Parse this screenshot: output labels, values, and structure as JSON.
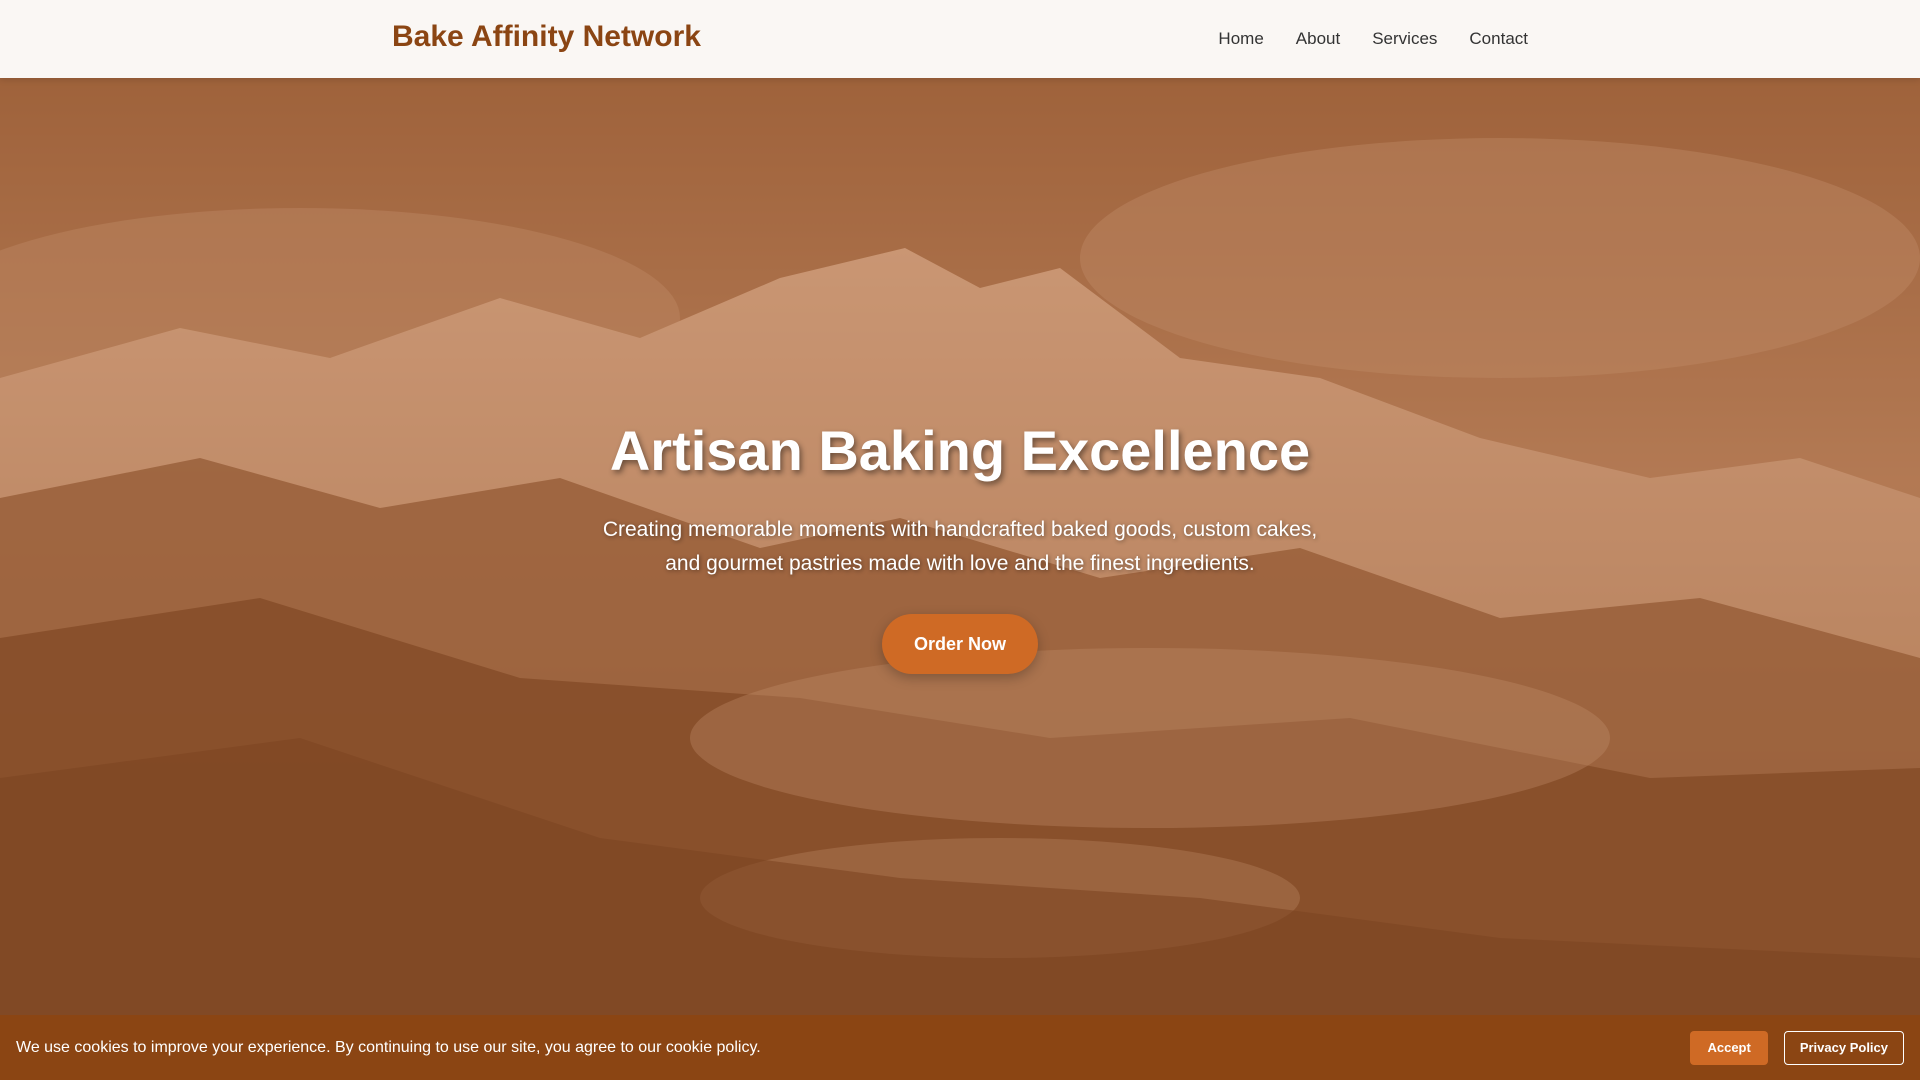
{
  "header": {
    "logo": "Bake Affinity Network",
    "nav": [
      "Home",
      "About",
      "Services",
      "Contact"
    ]
  },
  "hero": {
    "title": "Artisan Baking Excellence",
    "subtitle": "Creating memorable moments with handcrafted baked goods, custom cakes, and gourmet pastries made with love and the finest ingredients.",
    "cta_label": "Order Now",
    "background": "snowy-mountain-photo"
  },
  "cookie_banner": {
    "text": "We use cookies to improve your experience. By continuing to use our site, you agree to our cookie policy.",
    "accept_label": "Accept",
    "privacy_label": "Privacy Policy"
  },
  "colors": {
    "brand": "#8b4513",
    "accent": "#cf6a25",
    "header_bg": "#faf7f4",
    "overlay": "#b0581e"
  }
}
